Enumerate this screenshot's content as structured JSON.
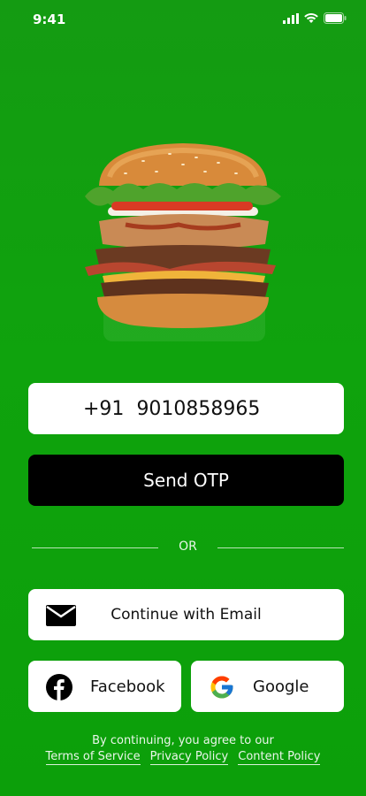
{
  "status_bar": {
    "time": "9:41",
    "icons": [
      "signal-icon",
      "wifi-icon",
      "battery-icon"
    ]
  },
  "hero": {
    "image": "burger-image"
  },
  "phone": {
    "country_code": "+91",
    "number": "9010858965"
  },
  "send_otp": {
    "label": "Send OTP"
  },
  "divider": {
    "label": "OR"
  },
  "email": {
    "label": "Continue with Email",
    "icon": "email-icon"
  },
  "facebook": {
    "label": "Facebook",
    "icon": "facebook-icon",
    "color": "#000000"
  },
  "google": {
    "label": "Google",
    "icon": "google-icon"
  },
  "legal": {
    "intro": "By continuing, you agree to our",
    "links": [
      "Terms of Service",
      "Privacy Policy",
      "Content Policy"
    ]
  },
  "colors": {
    "background": "#0FA30D",
    "button_dark": "#000000",
    "field": "#FFFFFF"
  }
}
